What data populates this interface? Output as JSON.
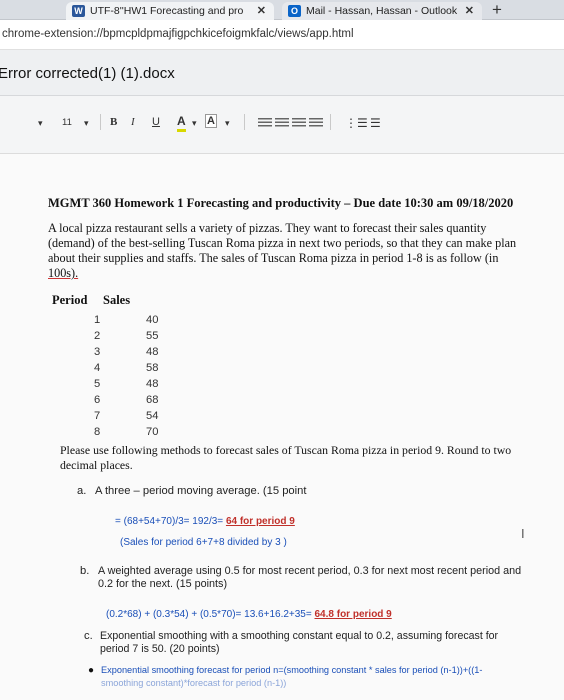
{
  "tabs": [
    {
      "icon": "W",
      "title": "UTF-8''HW1 Forecasting and pro",
      "close": "✕"
    },
    {
      "icon": "O",
      "title": "Mail - Hassan, Hassan - Outlook",
      "close": "✕"
    }
  ],
  "new_tab": "+",
  "url": "chrome-extension://bpmcpldpmajfigpchkicefoigmkfalc/views/app.html",
  "doc_title": "Error corrected(1) (1).docx",
  "toolbar": {
    "font_size": "11",
    "bold": "B",
    "italic": "I",
    "underline": "U",
    "font_color": "A",
    "highlight": "A",
    "dropdown": "▾",
    "list_numbered": "⋮☰",
    "list_bullets": "☰"
  },
  "document": {
    "heading": "MGMT 360 Homework 1 Forecasting and productivity – Due date 10:30 am 09/18/2020",
    "intro": [
      "A local pizza restaurant sells a variety of pizzas. They want to forecast their sales quantity",
      "(demand) of the best-selling Tuscan Roma pizza in next two periods, so that they can make plan",
      "about their supplies and staffs. The sales of Tuscan Roma pizza in period 1-8 is as follow (in",
      "100s)."
    ],
    "table": {
      "headers": [
        "Period",
        "Sales"
      ],
      "rows": [
        [
          "1",
          "40"
        ],
        [
          "2",
          "55"
        ],
        [
          "3",
          "48"
        ],
        [
          "4",
          "58"
        ],
        [
          "5",
          "48"
        ],
        [
          "6",
          "68"
        ],
        [
          "7",
          "54"
        ],
        [
          "8",
          "70"
        ]
      ]
    },
    "instructions": [
      "Please use following methods to forecast sales of Tuscan Roma pizza in period 9. Round to two",
      "decimal places."
    ],
    "question_a": {
      "label": "a.",
      "text": "A three – period moving average. (15 point",
      "calc": "= (68+54+70)/3= 192/3= ",
      "answer": "64  for period 9",
      "note": "(Sales for period 6+7+8 divided by 3 )"
    },
    "question_b": {
      "label": "b.",
      "text_lines": [
        "A weighted average using 0.5 for most recent period, 0.3 for next most recent period and",
        "0.2 for the next. (15 points)"
      ],
      "calc": "(0.2*68) + (0.3*54) + (0.5*70)= 13.6+16.2+35= ",
      "answer": "64.8 for period 9"
    },
    "question_c": {
      "label": "c.",
      "text_lines": [
        "Exponential smoothing with a smoothing constant equal to 0.2, assuming forecast for",
        "period 7 is 50. (20 points)"
      ],
      "bullet_text": "Exponential smoothing forecast for period n=(smoothing constant * sales for period (n-1))+((1-",
      "bullet_cont": "smoothing constant)*forecast for period (n-1))"
    },
    "cursor_glyph": "I"
  }
}
